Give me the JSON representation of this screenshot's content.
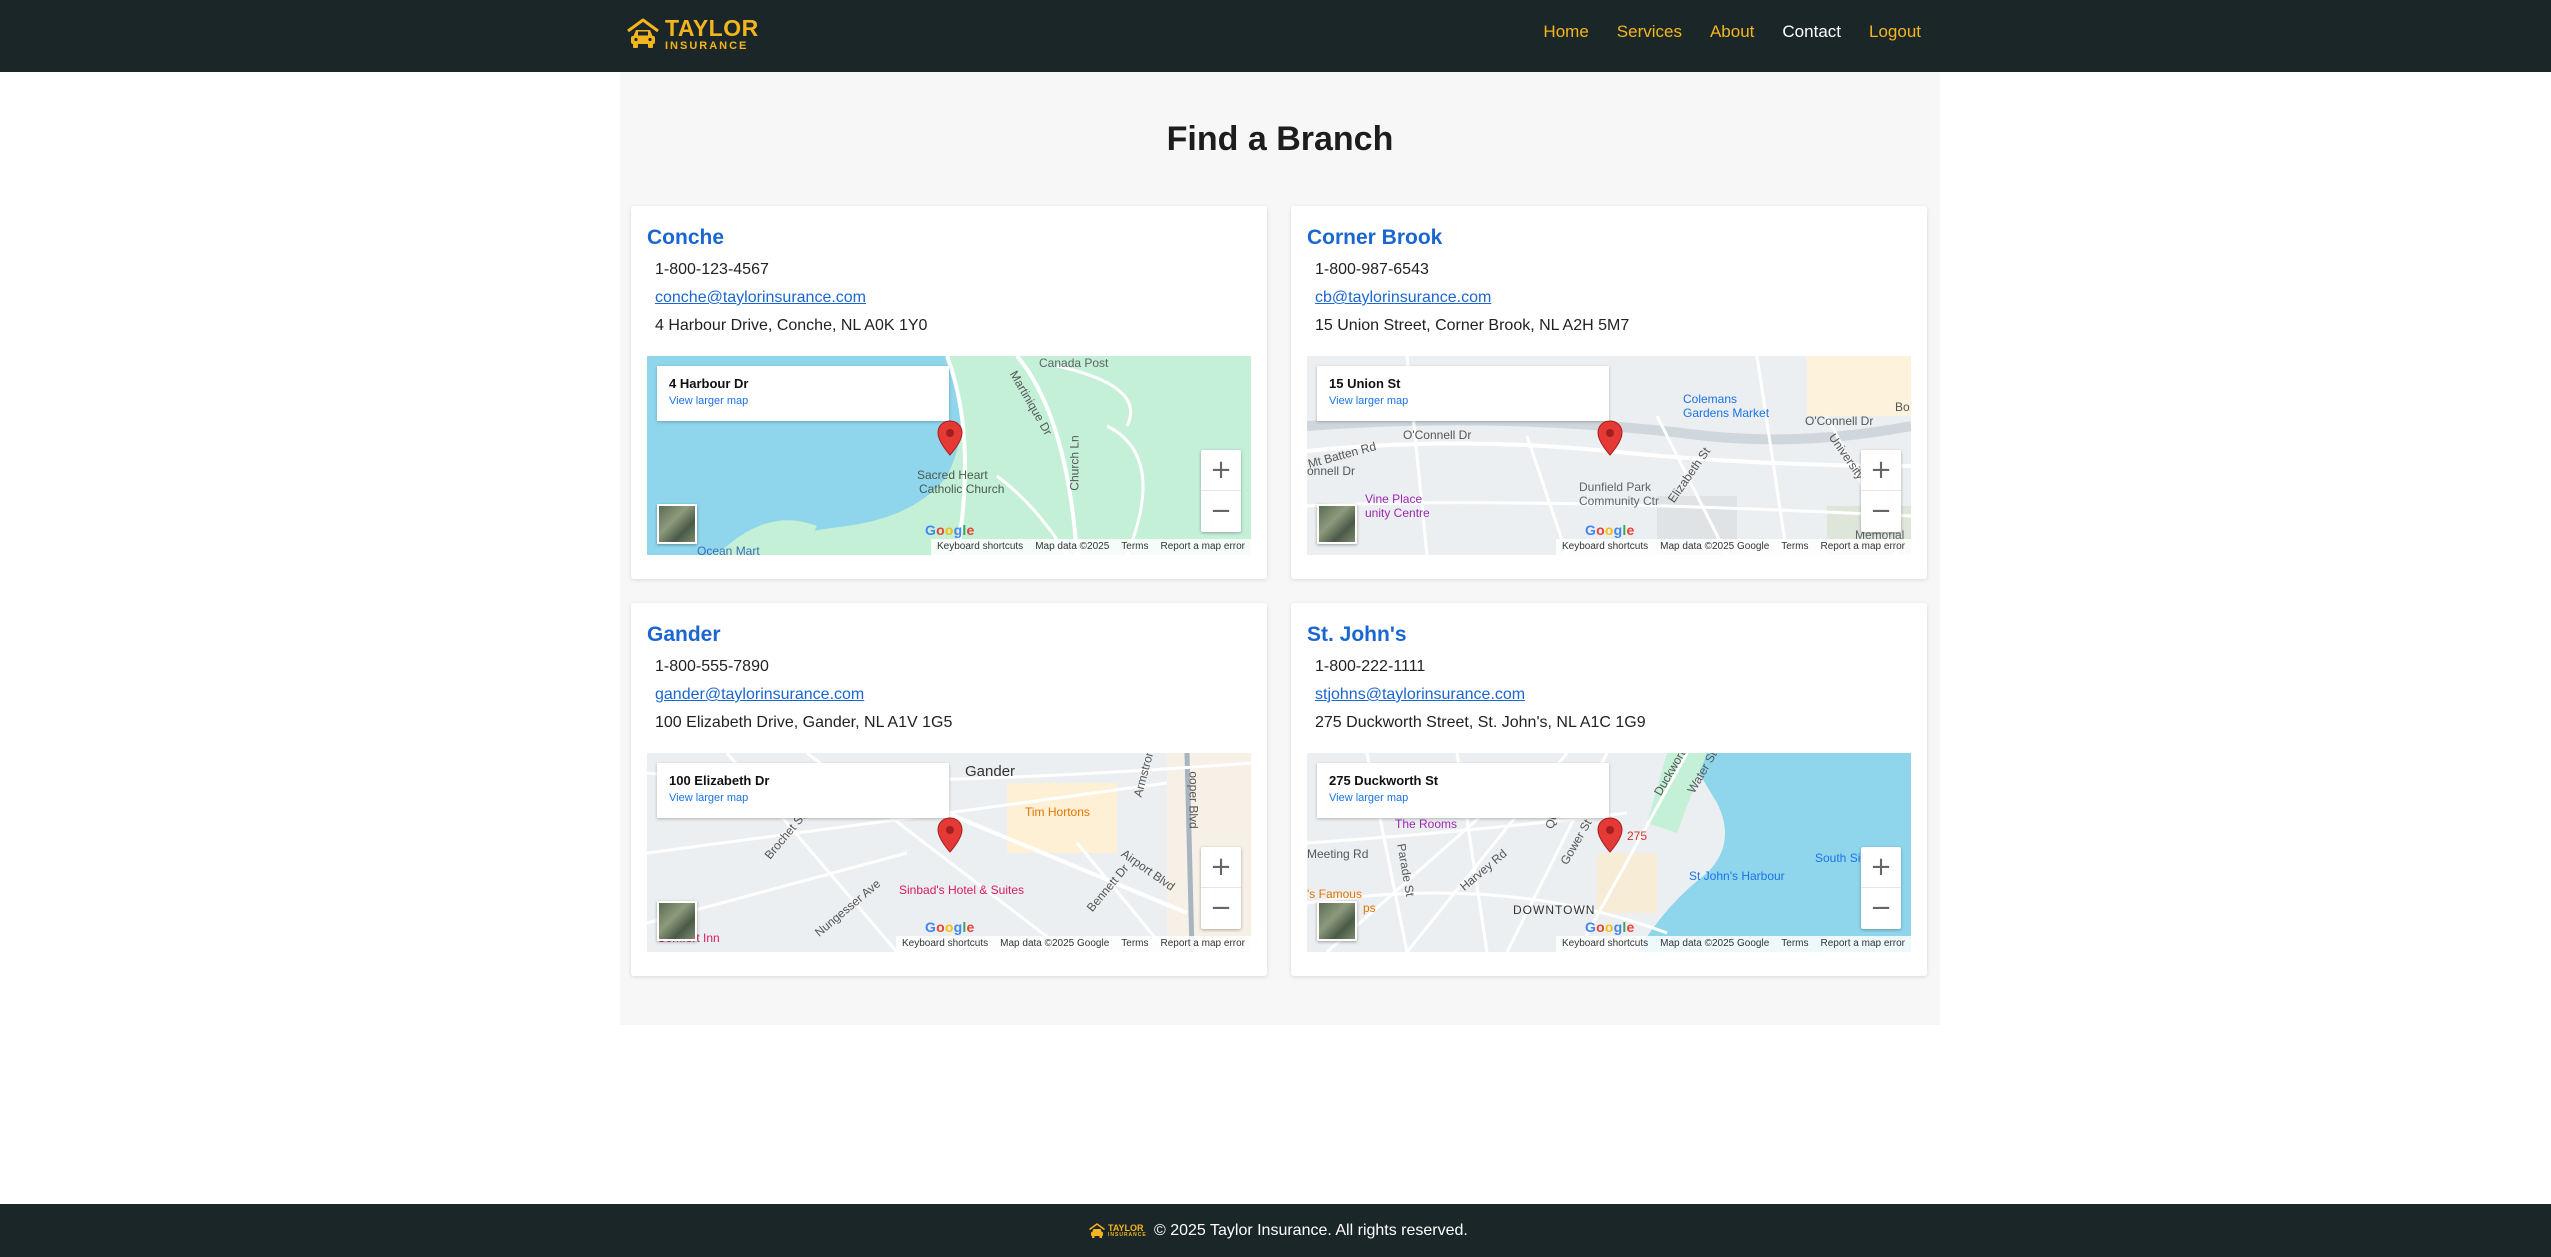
{
  "brand": {
    "line1": "TAYLOR",
    "line2": "INSURANCE",
    "color": "#f3b51d",
    "icon": "car-icon"
  },
  "nav": {
    "home": "Home",
    "services": "Services",
    "about": "About",
    "contact": "Contact",
    "logout": "Logout",
    "active": "contact"
  },
  "page": {
    "title": "Find a Branch"
  },
  "branches": [
    {
      "name": "Conche",
      "phone": "1-800-123-4567",
      "email": "conche@taylorinsurance.com",
      "address": "4 Harbour Drive, Conche, NL A0K 1Y0",
      "map": {
        "place": "4 Harbour Dr",
        "link": "View larger map",
        "labels": [
          "Canada Post",
          "Martinique Dr",
          "Church Ln",
          "Sacred Heart",
          "Catholic Church",
          "Ocean Mart"
        ],
        "attribution": [
          "Keyboard shortcuts",
          "Map data ©2025",
          "Terms",
          "Report a map error"
        ]
      }
    },
    {
      "name": "Corner Brook",
      "phone": "1-800-987-6543",
      "email": "cb@taylorinsurance.com",
      "address": "15 Union Street, Corner Brook, NL A2H 5M7",
      "map": {
        "place": "15 Union St",
        "link": "View larger map",
        "labels": [
          "Colemans",
          "Gardens Market",
          "O'Connell Dr",
          "O'Connell Dr",
          "Dunfield Park",
          "Community Ctr",
          "Vine Place",
          "unity Centre",
          "Elizabeth St",
          "University Dr",
          "Memorial",
          "Mt Batten Rd",
          "onnell Dr",
          "Bo"
        ],
        "attribution": [
          "Keyboard shortcuts",
          "Map data ©2025 Google",
          "Terms",
          "Report a map error"
        ]
      }
    },
    {
      "name": "Gander",
      "phone": "1-800-555-7890",
      "email": "gander@taylorinsurance.com",
      "address": "100 Elizabeth Drive, Gander, NL A1V 1G5",
      "map": {
        "place": "100 Elizabeth Dr",
        "link": "View larger map",
        "labels": [
          "Gander",
          "Tim Hortons",
          "Airport Blvd",
          "Bennett Dr",
          "Sinbad's Hotel & Suites",
          "Nungesser Ave",
          "Brochet St",
          "Comfort Inn",
          "Armstrong",
          "ooper Blvd"
        ],
        "attribution": [
          "Keyboard shortcuts",
          "Map data ©2025 Google",
          "Terms",
          "Report a map error"
        ]
      }
    },
    {
      "name": "St. John's",
      "phone": "1-800-222-1111",
      "email": "stjohns@taylorinsurance.com",
      "address": "275 Duckworth Street, St. John's, NL A1C 1G9",
      "map": {
        "place": "275 Duckworth St",
        "link": "View larger map",
        "labels": [
          "The Rooms",
          "275",
          "St John's Harbour",
          "South Side F",
          "DOWNTOWN",
          "Harvey Rd",
          "Gower St",
          "Queen Rd",
          "Parade St",
          "Meeting Rd",
          "Duckworth",
          "Water St",
          "'s Famous",
          "ps"
        ],
        "attribution": [
          "Keyboard shortcuts",
          "Map data ©2025 Google",
          "Terms",
          "Report a map error"
        ]
      }
    }
  ],
  "map_controls": {
    "zoom_in": "+",
    "zoom_out": "−",
    "google": [
      "G",
      "o",
      "o",
      "g",
      "l",
      "e"
    ]
  },
  "footer": {
    "copyright": "© 2025 Taylor Insurance. All rights reserved.",
    "logo_line1": "TAYLOR",
    "logo_line2": "INSURANCE"
  },
  "colors": {
    "nav_bg": "#1b2628",
    "accent": "#f3b51d",
    "link": "#1a66d2",
    "water": "#8fd6ec",
    "park": "#c4f0d8",
    "pin": "#e53935"
  }
}
